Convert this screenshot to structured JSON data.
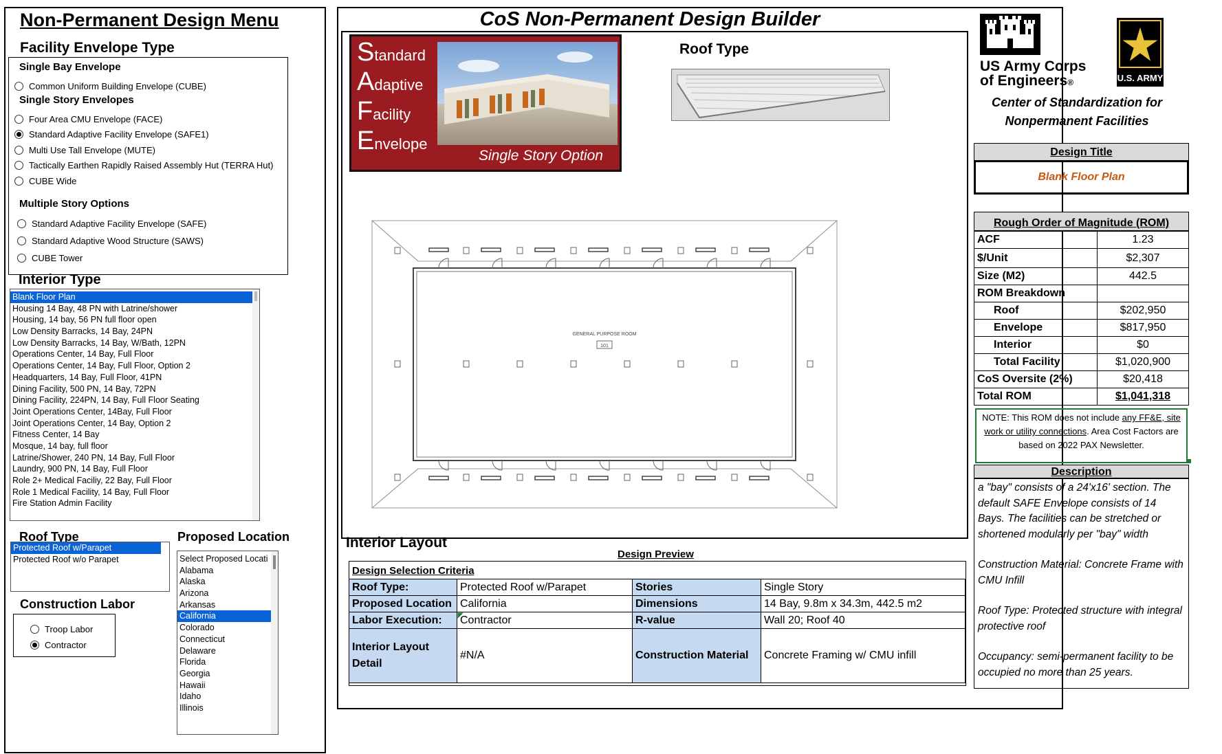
{
  "menu": {
    "title": "Non-Permanent Design Menu",
    "envelope_heading": "Facility Envelope Type",
    "single_bay_heading": "Single Bay Envelope",
    "single_story_heading": "Single Story Envelopes",
    "multi_story_heading": "Multiple Story Options",
    "single_bay": [
      {
        "label": "Common Uniform Building Envelope (CUBE)",
        "checked": false
      }
    ],
    "single_story": [
      {
        "label": "Four Area CMU Envelope (FACE)",
        "checked": false
      },
      {
        "label": "Standard Adaptive  Facility Envelope (SAFE1)",
        "checked": true
      },
      {
        "label": "Multi Use Tall Envelope (MUTE)",
        "checked": false
      },
      {
        "label": "Tactically Earthen Rapidly Raised Assembly Hut (TERRA Hut)",
        "checked": false
      },
      {
        "label": "CUBE Wide",
        "checked": false
      }
    ],
    "multi_story": [
      {
        "label": "Standard Adaptive Facility Envelope (SAFE)",
        "checked": false
      },
      {
        "label": "Standard Adaptive Wood Structure (SAWS)",
        "checked": false
      },
      {
        "label": "CUBE Tower",
        "checked": false
      }
    ],
    "interior_heading": "Interior Type",
    "interior_items": [
      "Blank Floor Plan",
      "Housing 14 Bay, 48 PN with Latrine/shower",
      "Housing, 14 bay, 56 PN full floor open",
      "Low Density Barracks, 14 Bay, 24PN",
      "Low Density Barracks, 14 Bay, W/Bath, 12PN",
      "Operations Center, 14 Bay, Full Floor",
      "Operations Center, 14 Bay, Full Floor, Option 2",
      "Headquarters, 14 Bay, Full Floor, 41PN",
      "Dining Facility, 500 PN, 14 Bay, 72PN",
      "Dining Facility, 224PN, 14 Bay, Full Floor Seating",
      "Joint Operations Center, 14Bay, Full Floor",
      "Joint Operations Center, 14 Bay, Option 2",
      "Fitness Center, 14 Bay",
      "Mosque, 14 bay,  full floor",
      "Latrine/Shower, 240 PN, 14 Bay, Full Floor",
      "Laundry, 900 PN, 14 Bay, Full Floor",
      "Role 2+ Medical Faciliy, 22 Bay, Full Floor",
      "Role 1 Medical Facility, 14 Bay, Full Floor",
      "Fire Station Admin Facility"
    ],
    "interior_selected": 0,
    "roof_heading": "Roof Type",
    "roof_items": [
      "Protected Roof w/Parapet",
      "Protected Roof w/o Parapet"
    ],
    "roof_selected": 0,
    "location_heading": "Proposed Location",
    "location_items": [
      "Select Proposed Locati",
      "Alabama",
      "Alaska",
      "Arizona",
      "Arkansas",
      "California",
      "Colorado",
      "Connecticut",
      "Delaware",
      "Florida",
      "Georgia",
      "Hawaii",
      "Idaho",
      "Illinois"
    ],
    "location_selected": 5,
    "labor_heading": "Construction Labor",
    "labor_options": [
      {
        "label": "Troop Labor",
        "checked": false
      },
      {
        "label": "Contractor",
        "checked": true
      }
    ]
  },
  "builder": {
    "title": "CoS Non-Permanent Design Builder",
    "safe_letters": [
      {
        "cap": "S",
        "rest": "tandard"
      },
      {
        "cap": "A",
        "rest": "daptive"
      },
      {
        "cap": "F",
        "rest": "acility"
      },
      {
        "cap": "E",
        "rest": "nvelope"
      }
    ],
    "safe_option": "Single Story Option",
    "roof_label": "Roof Type",
    "room_name": "GENERAL PURPOSE ROOM",
    "room_number": "101",
    "interior_layout_heading": "Interior Layout",
    "design_preview": "Design Preview",
    "criteria_heading": "Design Selection Criteria",
    "criteria": {
      "roof_label": "Roof Type:",
      "roof_value": "Protected Roof w/Parapet",
      "stories_label": "Stories",
      "stories_value": "Single Story",
      "location_label": "Proposed Location",
      "location_value": "California",
      "dimensions_label": "Dimensions",
      "dimensions_value": "14 Bay, 9.8m x 34.3m, 442.5 m2",
      "labor_label": "Labor Execution:",
      "labor_value": "Contractor",
      "rvalue_label": "R-value",
      "rvalue_value": "Wall 20; Roof 40",
      "interior_label": "Interior Layout Detail",
      "interior_value": "#N/A",
      "material_label": "Construction Material",
      "material_value": "Concrete Framing w/ CMU infill"
    }
  },
  "org": {
    "usace_line1": "US Army Corps",
    "usace_line2": "of Engineers",
    "usace_reg": "®",
    "army_badge": "U.S. ARMY",
    "cos_line1": "Center of Standardization for",
    "cos_line2": "Nonpermanent Facilities"
  },
  "design_title": {
    "heading": "Design Title",
    "value": "Blank Floor Plan"
  },
  "rom": {
    "heading": "Rough Order of Magnitude (ROM)",
    "acf_label": "ACF",
    "acf_value": "1.23",
    "unit_label": "$/Unit",
    "unit_value": "$2,307",
    "size_label": "Size (M2)",
    "size_value": "442.5",
    "breakdown_label": "ROM Breakdown",
    "roof_label": "Roof",
    "roof_value": "$202,950",
    "envelope_label": "Envelope",
    "envelope_value": "$817,950",
    "interior_label": "Interior",
    "interior_value": "$0",
    "total_facility_label": "Total Facility",
    "total_facility_value": "$1,020,900",
    "oversite_label": "CoS Oversite (2%)",
    "oversite_value": "$20,418",
    "total_rom_label": "Total ROM",
    "total_rom_value": "$1,041,318",
    "note_prefix": "NOTE: This ROM does not include ",
    "note_underlined": "any FF&E,  site work or utility connections",
    "note_suffix": ". Area Cost Factors are based on 2022 PAX Newsletter."
  },
  "description": {
    "heading": "Description",
    "p1": "a \"bay\" consists of a 24'x16' section. The default SAFE Envelope consists of 14 Bays. The facilities can be stretched or shortened modularly per \"bay\" width",
    "p2": "Construction Material: Concrete Frame with CMU Infill",
    "p3": "Roof Type: Protected structure with integral protective roof",
    "p4": "Occupancy: semi-permanent facility to be occupied no more than 25 years."
  },
  "colors": {
    "selection_blue": "#0a64d8",
    "safe_red": "#9b1c20",
    "criteria_label_blue": "#c5d9f1",
    "design_title_orange": "#c55a11",
    "note_green": "#1e7b34",
    "panel_gray": "#d9d9d9"
  }
}
